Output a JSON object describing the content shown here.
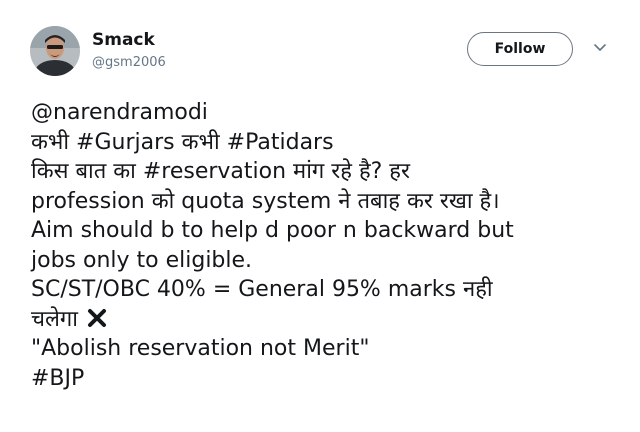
{
  "user": {
    "display_name": "Smack",
    "handle": "@gsm2006",
    "avatar_icon": "profile-photo"
  },
  "actions": {
    "follow_label": "Follow",
    "menu_icon": "chevron-down-icon"
  },
  "tweet": {
    "lines": [
      "@narendramodi",
      "कभी #Gurjars कभी #Patidars",
      "किस बात का #reservation मांग रहे है? हर",
      "profession को quota system ने तबाह कर रखा है।",
      "Aim should b to help d poor n backward but",
      "jobs only to eligible.",
      "SC/ST/OBC 40% = General 95% marks नही",
      "चलेगा",
      "\"Abolish reservation not Merit\"",
      "#BJP"
    ],
    "emoji_icon": "cross-mark-icon"
  },
  "colors": {
    "text": "#14171a",
    "secondary": "#657786",
    "border": "#6e767d"
  }
}
